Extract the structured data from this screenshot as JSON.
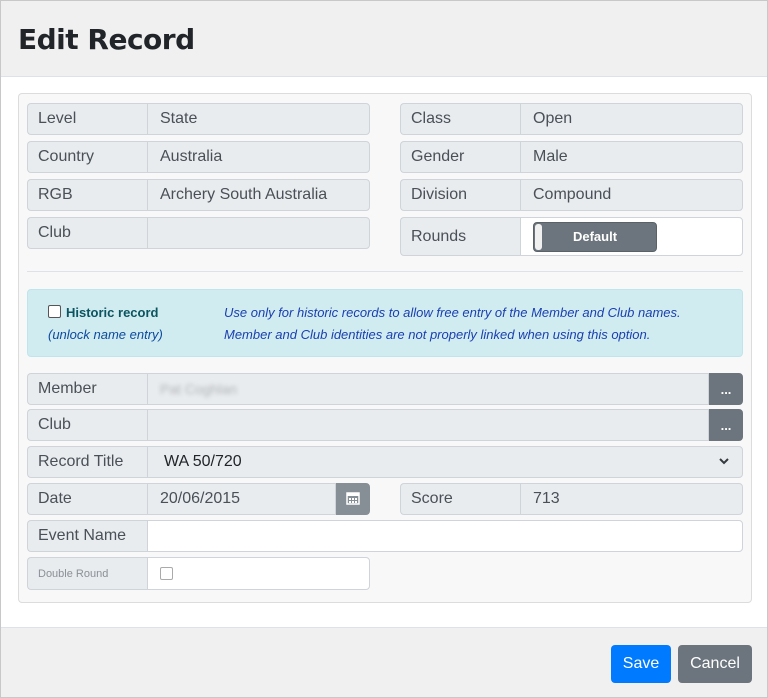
{
  "modal": {
    "title": "Edit Record"
  },
  "info": {
    "level": {
      "label": "Level",
      "value": "State"
    },
    "country": {
      "label": "Country",
      "value": "Australia"
    },
    "rgb": {
      "label": "RGB",
      "value": "Archery South Australia"
    },
    "club": {
      "label": "Club",
      "value": ""
    },
    "class": {
      "label": "Class",
      "value": "Open"
    },
    "gender": {
      "label": "Gender",
      "value": "Male"
    },
    "division": {
      "label": "Division",
      "value": "Compound"
    },
    "rounds": {
      "label": "Rounds",
      "toggle_label": "Default"
    }
  },
  "historic": {
    "checkbox_label": "Historic record",
    "sublabel": "(unlock name entry)",
    "note_line1": "Use only for historic records to allow free entry of the Member and Club names.",
    "note_line2": "Member and Club identities are not properly linked when using this option."
  },
  "form": {
    "member": {
      "label": "Member",
      "value": "Pat Coghlan",
      "button": "..."
    },
    "club": {
      "label": "Club",
      "value": "",
      "button": "..."
    },
    "record_title": {
      "label": "Record Title",
      "value": "WA 50/720"
    },
    "date": {
      "label": "Date",
      "value": "20/06/2015"
    },
    "score": {
      "label": "Score",
      "value": "713"
    },
    "event_name": {
      "label": "Event Name",
      "value": ""
    },
    "double_round": {
      "label": "Double Round"
    }
  },
  "footer": {
    "save": "Save",
    "cancel": "Cancel"
  },
  "colors": {
    "primary": "#007bff",
    "secondary": "#6c757d",
    "info_bg": "#d1ecf1"
  }
}
